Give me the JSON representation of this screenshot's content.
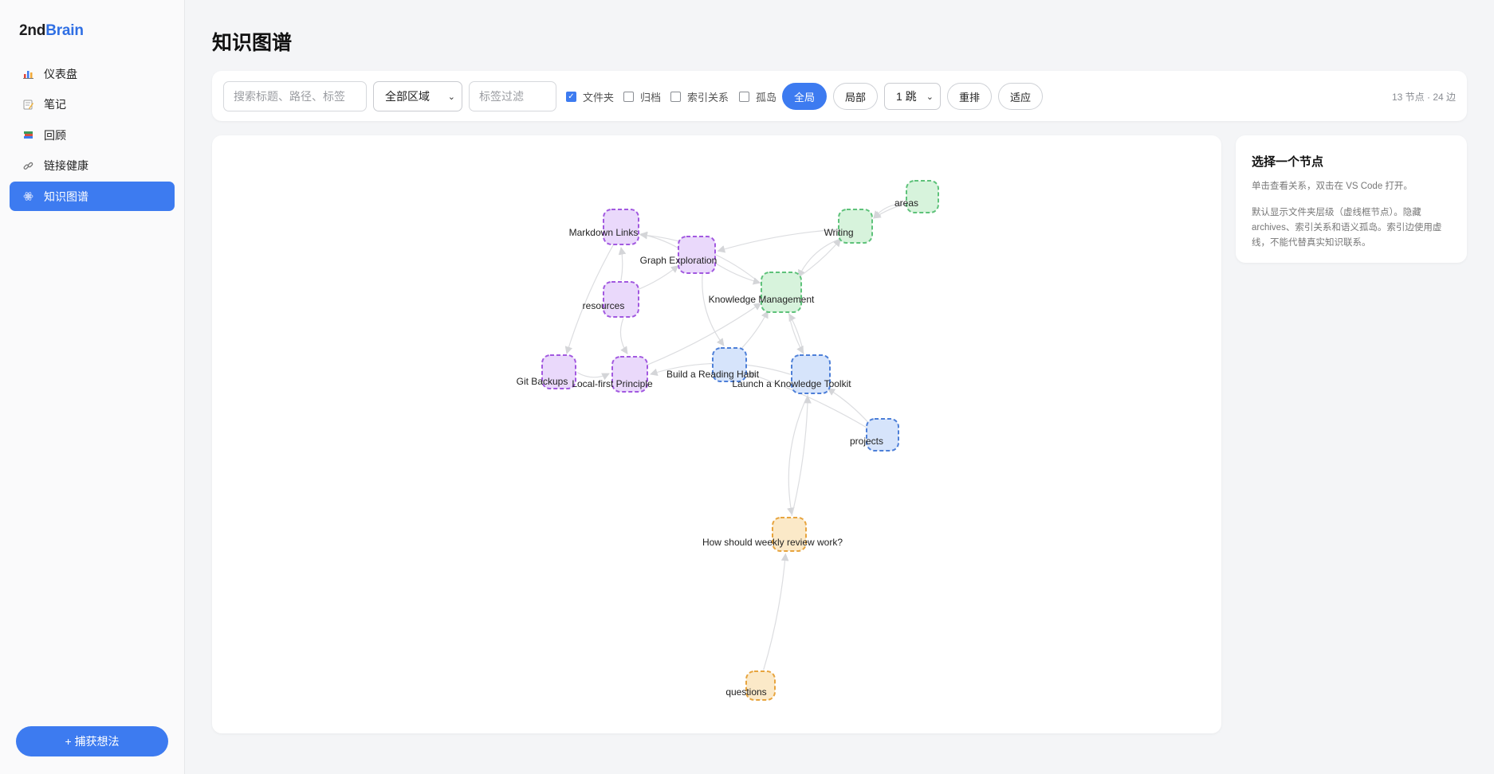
{
  "brand": {
    "part1": "2nd",
    "part2": "Brain",
    "accent": "#2f6fe4"
  },
  "sidebar": {
    "items": [
      {
        "label": "仪表盘",
        "icon": "bar-chart-icon",
        "active": false
      },
      {
        "label": "笔记",
        "icon": "memo-icon",
        "active": false
      },
      {
        "label": "回顾",
        "icon": "books-icon",
        "active": false
      },
      {
        "label": "链接健康",
        "icon": "link-icon",
        "active": false
      },
      {
        "label": "知识图谱",
        "icon": "graph-icon",
        "active": true
      }
    ],
    "capture_label": "+ 捕获想法"
  },
  "page": {
    "title": "知识图谱"
  },
  "toolbar": {
    "search_placeholder": "搜索标题、路径、标签",
    "region_select": "全部区域",
    "tag_placeholder": "标签过滤",
    "checks": [
      {
        "label": "文件夹",
        "checked": true
      },
      {
        "label": "归档",
        "checked": false
      },
      {
        "label": "索引关系",
        "checked": false
      },
      {
        "label": "孤岛",
        "checked": false
      }
    ],
    "global_label": "全局",
    "local_label": "局部",
    "hops_select": "1 跳",
    "relayout_label": "重排",
    "fit_label": "适应",
    "stats": "13 节点 · 24 边"
  },
  "info": {
    "title": "选择一个节点",
    "hint": "单击查看关系，双击在 VS Code 打开。",
    "desc": "默认显示文件夹层级（虚线框节点）。隐藏 archives、索引关系和语义孤岛。索引边使用虚线，不能代替真实知识联系。"
  },
  "graph": {
    "colors": {
      "purple": {
        "fill": "#ead9fb",
        "stroke": "#a259e0"
      },
      "green": {
        "fill": "#d7f3dc",
        "stroke": "#5ec27a"
      },
      "blue": {
        "fill": "#d6e4fb",
        "stroke": "#4d7fd8"
      },
      "orange": {
        "fill": "#fbe9c8",
        "stroke": "#e7a43e"
      }
    },
    "nodes": [
      {
        "id": "markdown",
        "label": "Markdown Links",
        "color": "purple"
      },
      {
        "id": "graphexp",
        "label": "Graph Exploration",
        "color": "purple"
      },
      {
        "id": "resources",
        "label": "resources",
        "color": "purple"
      },
      {
        "id": "gitbackups",
        "label": "Git Backups",
        "color": "purple"
      },
      {
        "id": "localfirst",
        "label": "Local-first Principle",
        "color": "purple"
      },
      {
        "id": "writing",
        "label": "Writing",
        "color": "green"
      },
      {
        "id": "areas",
        "label": "areas",
        "color": "green"
      },
      {
        "id": "km",
        "label": "Knowledge Management",
        "color": "green"
      },
      {
        "id": "reading",
        "label": "Build a Reading Habit",
        "color": "blue"
      },
      {
        "id": "toolkit",
        "label": "Launch a Knowledge Toolkit",
        "color": "blue"
      },
      {
        "id": "projects",
        "label": "projects",
        "color": "blue"
      },
      {
        "id": "weekly",
        "label": "How should weekly review work?",
        "color": "orange"
      },
      {
        "id": "questions",
        "label": "questions",
        "color": "orange"
      }
    ],
    "edges": [
      [
        "areas",
        "writing"
      ],
      [
        "areas",
        "writing"
      ],
      [
        "writing",
        "graphexp"
      ],
      [
        "writing",
        "km"
      ],
      [
        "km",
        "writing"
      ],
      [
        "graphexp",
        "markdown"
      ],
      [
        "km",
        "markdown"
      ],
      [
        "graphexp",
        "km"
      ],
      [
        "resources",
        "graphexp"
      ],
      [
        "resources",
        "localfirst"
      ],
      [
        "resources",
        "markdown"
      ],
      [
        "markdown",
        "gitbackups"
      ],
      [
        "gitbackups",
        "localfirst"
      ],
      [
        "localfirst",
        "km"
      ],
      [
        "reading",
        "km"
      ],
      [
        "toolkit",
        "localfirst"
      ],
      [
        "toolkit",
        "km"
      ],
      [
        "km",
        "toolkit"
      ],
      [
        "graphexp",
        "reading"
      ],
      [
        "projects",
        "toolkit"
      ],
      [
        "projects",
        "reading"
      ],
      [
        "toolkit",
        "weekly"
      ],
      [
        "weekly",
        "toolkit"
      ],
      [
        "questions",
        "weekly"
      ]
    ]
  }
}
